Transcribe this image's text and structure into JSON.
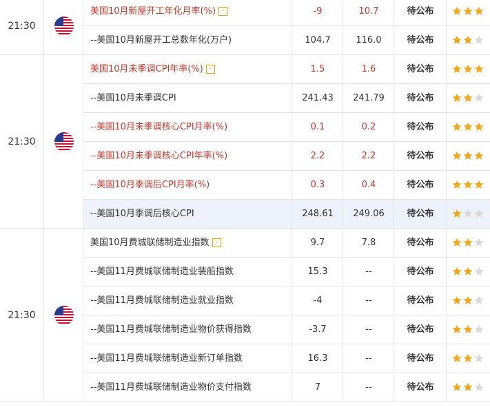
{
  "colors": {
    "red_text": "#c0382b",
    "star_on": "#f2a81d",
    "star_off": "#d9d9d9",
    "highlight": "#eef3fb"
  },
  "groups": [
    {
      "time": "21:30",
      "flag_icon": "us-flag-icon",
      "rows": [
        {
          "name": "美国10月新屋开工年化月率(%)",
          "expand": true,
          "prev": "-9",
          "cons": "10.7",
          "actual": "待公布",
          "stars": 3,
          "red": true
        },
        {
          "name": "--美国10月新屋开工总数年化(万户)",
          "expand": false,
          "prev": "104.7",
          "cons": "116.0",
          "actual": "待公布",
          "stars": 2,
          "red": false
        }
      ]
    },
    {
      "time": "21:30",
      "flag_icon": "us-flag-icon",
      "rows": [
        {
          "name": "美国10月未季调CPI年率(%)",
          "expand": true,
          "prev": "1.5",
          "cons": "1.6",
          "actual": "待公布",
          "stars": 3,
          "red": true
        },
        {
          "name": "--美国10月未季调CPI",
          "expand": false,
          "prev": "241.43",
          "cons": "241.79",
          "actual": "待公布",
          "stars": 2,
          "red": false
        },
        {
          "name": "--美国10月未季调核心CPI月率(%)",
          "expand": false,
          "prev": "0.1",
          "cons": "0.2",
          "actual": "待公布",
          "stars": 3,
          "red": true
        },
        {
          "name": "--美国10月未季调核心CPI年率(%)",
          "expand": false,
          "prev": "2.2",
          "cons": "2.2",
          "actual": "待公布",
          "stars": 3,
          "red": true
        },
        {
          "name": "--美国10月季调后CPI月率(%)",
          "expand": false,
          "prev": "0.3",
          "cons": "0.4",
          "actual": "待公布",
          "stars": 3,
          "red": true
        },
        {
          "name": "--美国10月季调后核心CPI",
          "expand": false,
          "prev": "248.61",
          "cons": "249.06",
          "actual": "待公布",
          "stars": 1,
          "red": false,
          "highlight": true
        }
      ]
    },
    {
      "time": "21:30",
      "flag_icon": "us-flag-icon",
      "rows": [
        {
          "name": "美国10月费城联储制造业指数",
          "expand": true,
          "prev": "9.7",
          "cons": "7.8",
          "actual": "待公布",
          "stars": 2,
          "red": false
        },
        {
          "name": "--美国11月费城联储制造业装船指数",
          "expand": false,
          "prev": "15.3",
          "cons": "--",
          "actual": "待公布",
          "stars": 2,
          "red": false
        },
        {
          "name": "--美国11月费城联储制造业就业指数",
          "expand": false,
          "prev": "-4",
          "cons": "--",
          "actual": "待公布",
          "stars": 2,
          "red": false
        },
        {
          "name": "--美国11月费城联储制造业物价获得指数",
          "expand": false,
          "prev": "-3.7",
          "cons": "--",
          "actual": "待公布",
          "stars": 2,
          "red": false
        },
        {
          "name": "--美国11月费城联储制造业新订单指数",
          "expand": false,
          "prev": "16.3",
          "cons": "--",
          "actual": "待公布",
          "stars": 2,
          "red": false
        },
        {
          "name": "--美国11月费城联储制造业物价支付指数",
          "expand": false,
          "prev": "7",
          "cons": "--",
          "actual": "待公布",
          "stars": 2,
          "red": false
        }
      ]
    }
  ],
  "expand_label": "-"
}
